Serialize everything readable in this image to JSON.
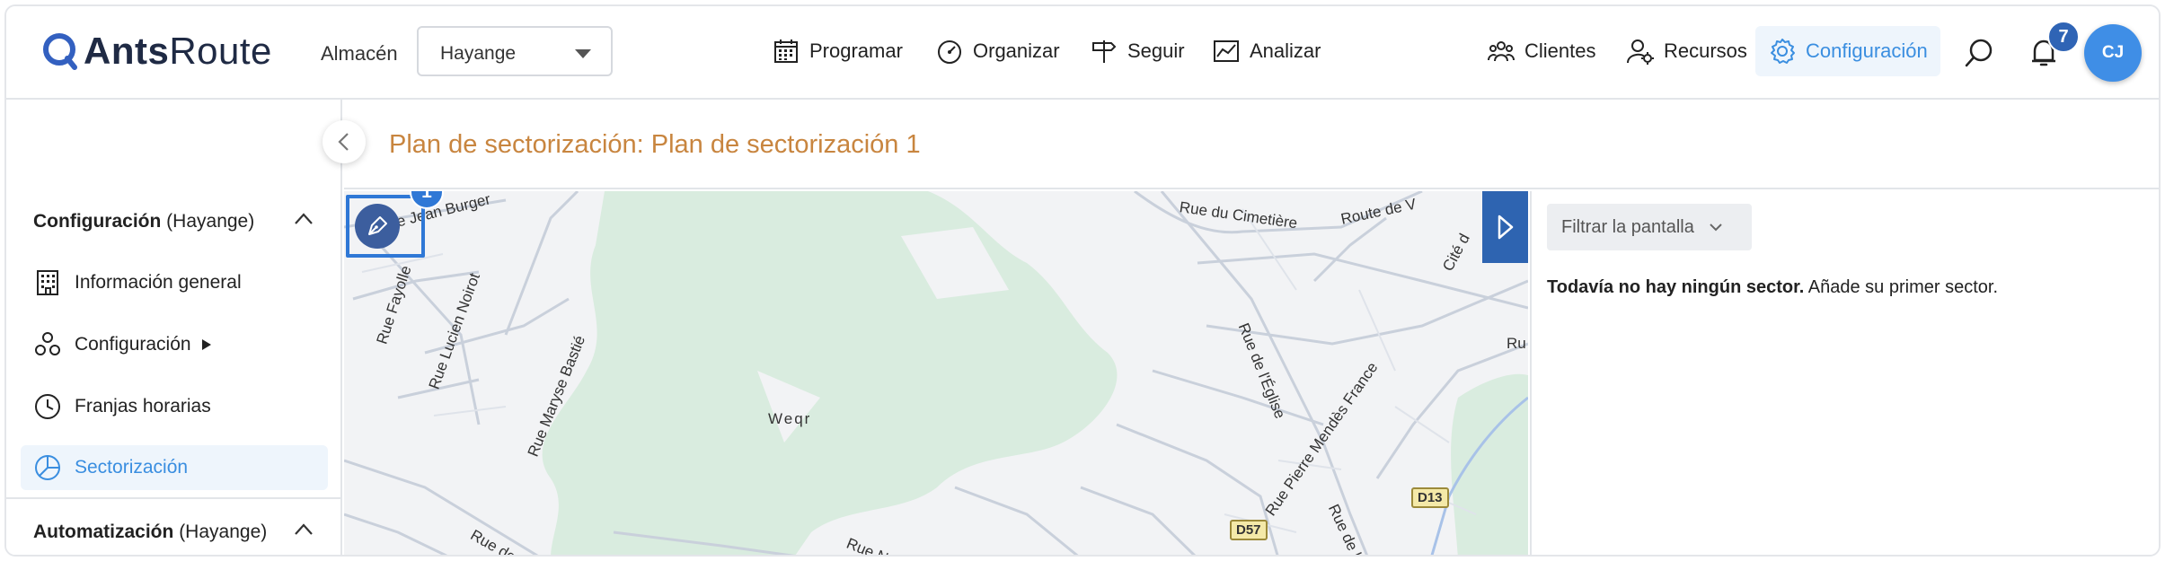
{
  "header": {
    "logo_strong": "Ants",
    "logo_light": "Route",
    "store_label": "Almacén",
    "store_value": "Hayange",
    "nav": {
      "programar": "Programar",
      "organizar": "Organizar",
      "seguir": "Seguir",
      "analizar": "Analizar",
      "clientes": "Clientes",
      "recursos": "Recursos",
      "configuracion": "Configuración"
    },
    "notification_count": "7",
    "avatar_initials": "CJ"
  },
  "sidebar": {
    "section1_title": "Configuración",
    "section1_context": "(Hayange)",
    "items": [
      {
        "label": "Información general"
      },
      {
        "label": "Configuración"
      },
      {
        "label": "Franjas horarias"
      },
      {
        "label": "Sectorización"
      }
    ],
    "section2_title": "Automatización",
    "section2_context": "(Hayange)"
  },
  "page": {
    "title": "Plan de sectorización: Plan de sectorización 1"
  },
  "map": {
    "draw_badge": "1",
    "labels": {
      "jean_burger": "Rue Jean Burger",
      "cimetiere": "Rue du Cimetière",
      "route_de": "Route de V",
      "cite_d": "Cité d",
      "fayolle": "Rue Fayolle",
      "lucien_noirot": "Rue Lucien Noirot",
      "maryse_bastie": "Rue Maryse Bastié",
      "weqr": "Weqr",
      "eglise": "Rue de l'Église",
      "mendes_france": "Rue Pierre Mendès France",
      "ru": "Ru",
      "rue_de_la_1": "Rue de la",
      "rue_de_la_2": "Rue de la",
      "rue_no": "Rue No"
    },
    "tags": {
      "d13": "D13",
      "d57": "D57"
    }
  },
  "panel": {
    "filter_label": "Filtrar la pantalla",
    "empty_strong": "Todavía no hay ningún sector.",
    "empty_rest": "Añade su primer sector."
  },
  "colors": {
    "accent": "#3a8ee0",
    "title": "#c8853f",
    "primary_dark": "#2e64b1",
    "map_green": "#d9ecdf"
  }
}
